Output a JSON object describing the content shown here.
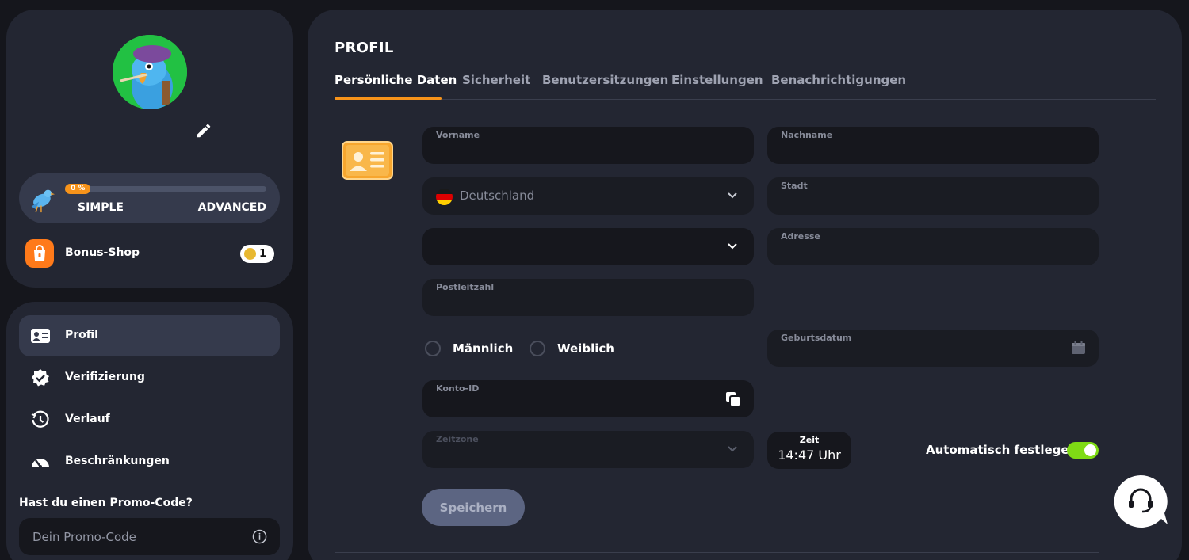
{
  "sidebar": {
    "level": {
      "progress_percent": 0,
      "progress_label": "0 %",
      "from": "SIMPLE",
      "to": "ADVANCED"
    },
    "bonus_shop": {
      "label": "Bonus-Shop",
      "count": "1"
    },
    "nav": [
      {
        "label": "Profil",
        "icon": "id-card-icon",
        "active": true
      },
      {
        "label": "Verifizierung",
        "icon": "verified-badge-icon",
        "active": false
      },
      {
        "label": "Verlauf",
        "icon": "history-icon",
        "active": false
      },
      {
        "label": "Beschränkungen",
        "icon": "gauge-icon",
        "active": false
      }
    ],
    "promo": {
      "title": "Hast du einen Promo-Code?",
      "placeholder": "Dein Promo-Code"
    }
  },
  "profile": {
    "title": "PROFIL",
    "tabs": [
      "Persönliche Daten",
      "Sicherheit",
      "Benutzersitzungen",
      "Einstellungen",
      "Benachrichtigungen"
    ],
    "active_tab": 0,
    "fields": {
      "first_name": {
        "label": "Vorname",
        "value": ""
      },
      "last_name": {
        "label": "Nachname",
        "value": ""
      },
      "country": {
        "value": "Deutschland"
      },
      "city": {
        "label": "Stadt",
        "value": ""
      },
      "region": {
        "value": ""
      },
      "address": {
        "label": "Adresse",
        "value": ""
      },
      "zip": {
        "label": "Postleitzahl",
        "value": ""
      },
      "birthdate": {
        "label": "Geburtsdatum",
        "value": ""
      },
      "account_id": {
        "label": "Konto-ID",
        "value": ""
      },
      "timezone": {
        "label": "Zeitzone",
        "value": ""
      }
    },
    "gender": {
      "male": "Männlich",
      "female": "Weiblich"
    },
    "time": {
      "label": "Zeit",
      "value": "14:47 Uhr"
    },
    "auto_set": {
      "label": "Automatisch festlegen",
      "enabled": true
    },
    "save_label": "Speichern"
  },
  "colors": {
    "accent": "#f7931a",
    "toggle_on": "#7fdb15",
    "panel": "#232632",
    "input": "#16171d",
    "avatar_bg": "#22c143",
    "bonus": "#ff7a1a"
  }
}
